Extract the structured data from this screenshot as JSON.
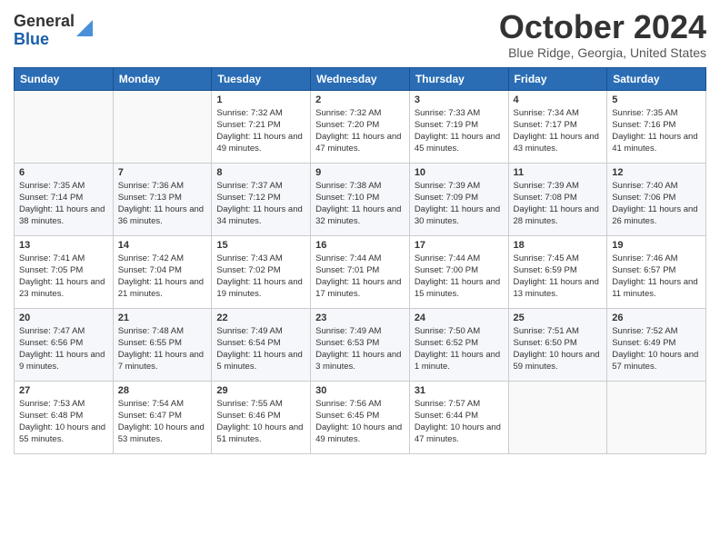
{
  "logo": {
    "general": "General",
    "blue": "Blue"
  },
  "header": {
    "month": "October 2024",
    "location": "Blue Ridge, Georgia, United States"
  },
  "weekdays": [
    "Sunday",
    "Monday",
    "Tuesday",
    "Wednesday",
    "Thursday",
    "Friday",
    "Saturday"
  ],
  "weeks": [
    [
      {
        "day": "",
        "sunrise": "",
        "sunset": "",
        "daylight": ""
      },
      {
        "day": "",
        "sunrise": "",
        "sunset": "",
        "daylight": ""
      },
      {
        "day": "1",
        "sunrise": "Sunrise: 7:32 AM",
        "sunset": "Sunset: 7:21 PM",
        "daylight": "Daylight: 11 hours and 49 minutes."
      },
      {
        "day": "2",
        "sunrise": "Sunrise: 7:32 AM",
        "sunset": "Sunset: 7:20 PM",
        "daylight": "Daylight: 11 hours and 47 minutes."
      },
      {
        "day": "3",
        "sunrise": "Sunrise: 7:33 AM",
        "sunset": "Sunset: 7:19 PM",
        "daylight": "Daylight: 11 hours and 45 minutes."
      },
      {
        "day": "4",
        "sunrise": "Sunrise: 7:34 AM",
        "sunset": "Sunset: 7:17 PM",
        "daylight": "Daylight: 11 hours and 43 minutes."
      },
      {
        "day": "5",
        "sunrise": "Sunrise: 7:35 AM",
        "sunset": "Sunset: 7:16 PM",
        "daylight": "Daylight: 11 hours and 41 minutes."
      }
    ],
    [
      {
        "day": "6",
        "sunrise": "Sunrise: 7:35 AM",
        "sunset": "Sunset: 7:14 PM",
        "daylight": "Daylight: 11 hours and 38 minutes."
      },
      {
        "day": "7",
        "sunrise": "Sunrise: 7:36 AM",
        "sunset": "Sunset: 7:13 PM",
        "daylight": "Daylight: 11 hours and 36 minutes."
      },
      {
        "day": "8",
        "sunrise": "Sunrise: 7:37 AM",
        "sunset": "Sunset: 7:12 PM",
        "daylight": "Daylight: 11 hours and 34 minutes."
      },
      {
        "day": "9",
        "sunrise": "Sunrise: 7:38 AM",
        "sunset": "Sunset: 7:10 PM",
        "daylight": "Daylight: 11 hours and 32 minutes."
      },
      {
        "day": "10",
        "sunrise": "Sunrise: 7:39 AM",
        "sunset": "Sunset: 7:09 PM",
        "daylight": "Daylight: 11 hours and 30 minutes."
      },
      {
        "day": "11",
        "sunrise": "Sunrise: 7:39 AM",
        "sunset": "Sunset: 7:08 PM",
        "daylight": "Daylight: 11 hours and 28 minutes."
      },
      {
        "day": "12",
        "sunrise": "Sunrise: 7:40 AM",
        "sunset": "Sunset: 7:06 PM",
        "daylight": "Daylight: 11 hours and 26 minutes."
      }
    ],
    [
      {
        "day": "13",
        "sunrise": "Sunrise: 7:41 AM",
        "sunset": "Sunset: 7:05 PM",
        "daylight": "Daylight: 11 hours and 23 minutes."
      },
      {
        "day": "14",
        "sunrise": "Sunrise: 7:42 AM",
        "sunset": "Sunset: 7:04 PM",
        "daylight": "Daylight: 11 hours and 21 minutes."
      },
      {
        "day": "15",
        "sunrise": "Sunrise: 7:43 AM",
        "sunset": "Sunset: 7:02 PM",
        "daylight": "Daylight: 11 hours and 19 minutes."
      },
      {
        "day": "16",
        "sunrise": "Sunrise: 7:44 AM",
        "sunset": "Sunset: 7:01 PM",
        "daylight": "Daylight: 11 hours and 17 minutes."
      },
      {
        "day": "17",
        "sunrise": "Sunrise: 7:44 AM",
        "sunset": "Sunset: 7:00 PM",
        "daylight": "Daylight: 11 hours and 15 minutes."
      },
      {
        "day": "18",
        "sunrise": "Sunrise: 7:45 AM",
        "sunset": "Sunset: 6:59 PM",
        "daylight": "Daylight: 11 hours and 13 minutes."
      },
      {
        "day": "19",
        "sunrise": "Sunrise: 7:46 AM",
        "sunset": "Sunset: 6:57 PM",
        "daylight": "Daylight: 11 hours and 11 minutes."
      }
    ],
    [
      {
        "day": "20",
        "sunrise": "Sunrise: 7:47 AM",
        "sunset": "Sunset: 6:56 PM",
        "daylight": "Daylight: 11 hours and 9 minutes."
      },
      {
        "day": "21",
        "sunrise": "Sunrise: 7:48 AM",
        "sunset": "Sunset: 6:55 PM",
        "daylight": "Daylight: 11 hours and 7 minutes."
      },
      {
        "day": "22",
        "sunrise": "Sunrise: 7:49 AM",
        "sunset": "Sunset: 6:54 PM",
        "daylight": "Daylight: 11 hours and 5 minutes."
      },
      {
        "day": "23",
        "sunrise": "Sunrise: 7:49 AM",
        "sunset": "Sunset: 6:53 PM",
        "daylight": "Daylight: 11 hours and 3 minutes."
      },
      {
        "day": "24",
        "sunrise": "Sunrise: 7:50 AM",
        "sunset": "Sunset: 6:52 PM",
        "daylight": "Daylight: 11 hours and 1 minute."
      },
      {
        "day": "25",
        "sunrise": "Sunrise: 7:51 AM",
        "sunset": "Sunset: 6:50 PM",
        "daylight": "Daylight: 10 hours and 59 minutes."
      },
      {
        "day": "26",
        "sunrise": "Sunrise: 7:52 AM",
        "sunset": "Sunset: 6:49 PM",
        "daylight": "Daylight: 10 hours and 57 minutes."
      }
    ],
    [
      {
        "day": "27",
        "sunrise": "Sunrise: 7:53 AM",
        "sunset": "Sunset: 6:48 PM",
        "daylight": "Daylight: 10 hours and 55 minutes."
      },
      {
        "day": "28",
        "sunrise": "Sunrise: 7:54 AM",
        "sunset": "Sunset: 6:47 PM",
        "daylight": "Daylight: 10 hours and 53 minutes."
      },
      {
        "day": "29",
        "sunrise": "Sunrise: 7:55 AM",
        "sunset": "Sunset: 6:46 PM",
        "daylight": "Daylight: 10 hours and 51 minutes."
      },
      {
        "day": "30",
        "sunrise": "Sunrise: 7:56 AM",
        "sunset": "Sunset: 6:45 PM",
        "daylight": "Daylight: 10 hours and 49 minutes."
      },
      {
        "day": "31",
        "sunrise": "Sunrise: 7:57 AM",
        "sunset": "Sunset: 6:44 PM",
        "daylight": "Daylight: 10 hours and 47 minutes."
      },
      {
        "day": "",
        "sunrise": "",
        "sunset": "",
        "daylight": ""
      },
      {
        "day": "",
        "sunrise": "",
        "sunset": "",
        "daylight": ""
      }
    ]
  ]
}
